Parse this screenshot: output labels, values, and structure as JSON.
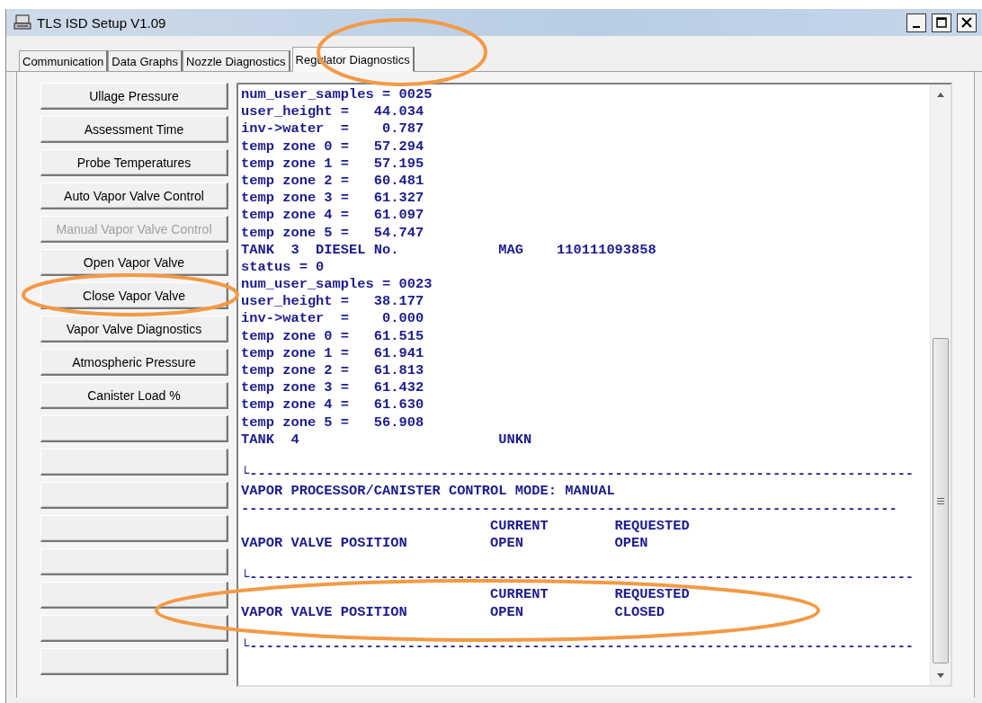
{
  "window": {
    "title": "TLS ISD Setup V1.09"
  },
  "tabs": [
    {
      "label": "Communication",
      "selected": false
    },
    {
      "label": "Data Graphs",
      "selected": false
    },
    {
      "label": "Nozzle Diagnostics",
      "selected": false
    },
    {
      "label": "Regulator Diagnostics",
      "selected": true
    }
  ],
  "buttons": [
    {
      "kind": "labeled",
      "label": "Ullage Pressure",
      "disabled": false
    },
    {
      "kind": "labeled",
      "label": "Assessment Time",
      "disabled": false
    },
    {
      "kind": "labeled",
      "label": "Probe Temperatures",
      "disabled": false
    },
    {
      "kind": "labeled",
      "label": "Auto Vapor Valve Control",
      "disabled": false
    },
    {
      "kind": "labeled",
      "label": "Manual Vapor Valve Control",
      "disabled": true
    },
    {
      "kind": "labeled",
      "label": "Open Vapor Valve",
      "disabled": false
    },
    {
      "kind": "labeled",
      "label": "Close Vapor Valve",
      "disabled": false
    },
    {
      "kind": "labeled",
      "label": "Vapor Valve Diagnostics",
      "disabled": false
    },
    {
      "kind": "labeled",
      "label": "Atmospheric Pressure",
      "disabled": false
    },
    {
      "kind": "labeled",
      "label": "Canister Load %",
      "disabled": false
    },
    {
      "kind": "blank"
    },
    {
      "kind": "blank"
    },
    {
      "kind": "blank"
    },
    {
      "kind": "blank"
    },
    {
      "kind": "blank"
    },
    {
      "kind": "blank"
    },
    {
      "kind": "blank"
    },
    {
      "kind": "blank"
    }
  ],
  "log": {
    "blocks": [
      [
        "num_user_samples = 0025",
        "user_height =   44.034",
        "inv->water  =    0.787",
        "temp zone 0 =   57.294",
        "temp zone 1 =   57.195",
        "temp zone 2 =   60.481",
        "temp zone 3 =   61.327",
        "temp zone 4 =   61.097",
        "temp zone 5 =   54.747",
        "TANK  3  DIESEL No.            MAG    110111093858",
        "status = 0",
        "num_user_samples = 0023",
        "user_height =   38.177",
        "inv->water  =    0.000",
        "temp zone 0 =   61.515",
        "temp zone 1 =   61.941",
        "temp zone 2 =   61.813",
        "temp zone 3 =   61.432",
        "temp zone 4 =   61.630",
        "temp zone 5 =   56.908",
        "TANK  4                        UNKN"
      ],
      [
        "└--------------------------------------------------------------------------------",
        "VAPOR PROCESSOR/CANISTER CONTROL MODE: MANUAL",
        "-------------------------------------------------------------------------------",
        "                              CURRENT        REQUESTED",
        "VAPOR VALVE POSITION          OPEN           OPEN"
      ],
      [
        "└--------------------------------------------------------------------------------",
        "                              CURRENT        REQUESTED",
        "VAPOR VALVE POSITION          OPEN           CLOSED"
      ],
      [
        "└--------------------------------------------------------------------------------"
      ]
    ]
  }
}
